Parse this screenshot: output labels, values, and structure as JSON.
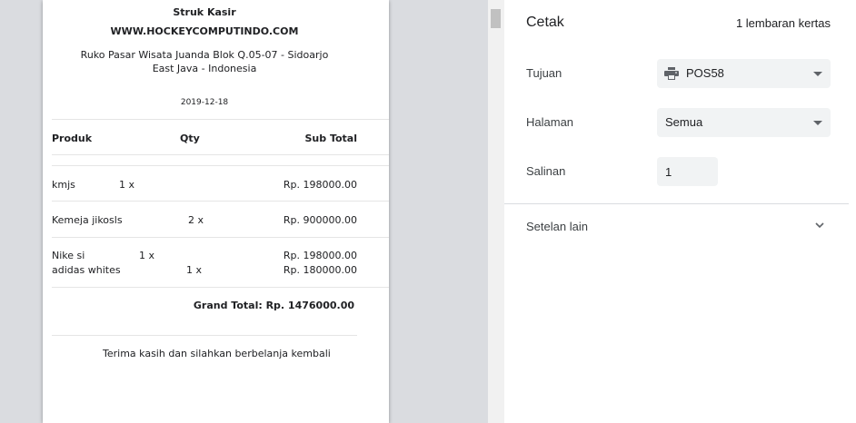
{
  "receipt": {
    "title": "Struk Kasir",
    "website": "WWW.HOCKEYCOMPUTINDO.COM",
    "address_line1": "Ruko Pasar Wisata Juanda Blok Q.05-07 - Sidoarjo",
    "address_line2": "East Java - Indonesia",
    "date": "2019-12-18",
    "headers": {
      "product": "Produk",
      "qty": "Qty",
      "subtotal": "Sub Total"
    },
    "items": [
      {
        "product": "kmjs",
        "qty": "1 x",
        "subtotal": "Rp. 198000.00"
      },
      {
        "product": "Kemeja jikosls",
        "qty": "2 x",
        "subtotal": "Rp. 900000.00"
      },
      {
        "product": "Nike si",
        "qty": "1 x",
        "subtotal": "Rp. 198000.00"
      },
      {
        "product": "adidas whites",
        "qty": "1 x",
        "subtotal": "Rp. 180000.00"
      }
    ],
    "grand_total": "Grand Total: Rp. 1476000.00",
    "footer": "Terima kasih dan silahkan berbelanja kembali"
  },
  "settings": {
    "title": "Cetak",
    "sheet_count": "1 lembaran kertas",
    "destination_label": "Tujuan",
    "destination_value": "POS58",
    "pages_label": "Halaman",
    "pages_value": "Semua",
    "copies_label": "Salinan",
    "copies_value": "1",
    "more_settings_label": "Setelan lain"
  },
  "icons": {
    "printer": "printer-icon",
    "dropdown": "chevron-down-icon",
    "expand": "expand-more-icon"
  }
}
